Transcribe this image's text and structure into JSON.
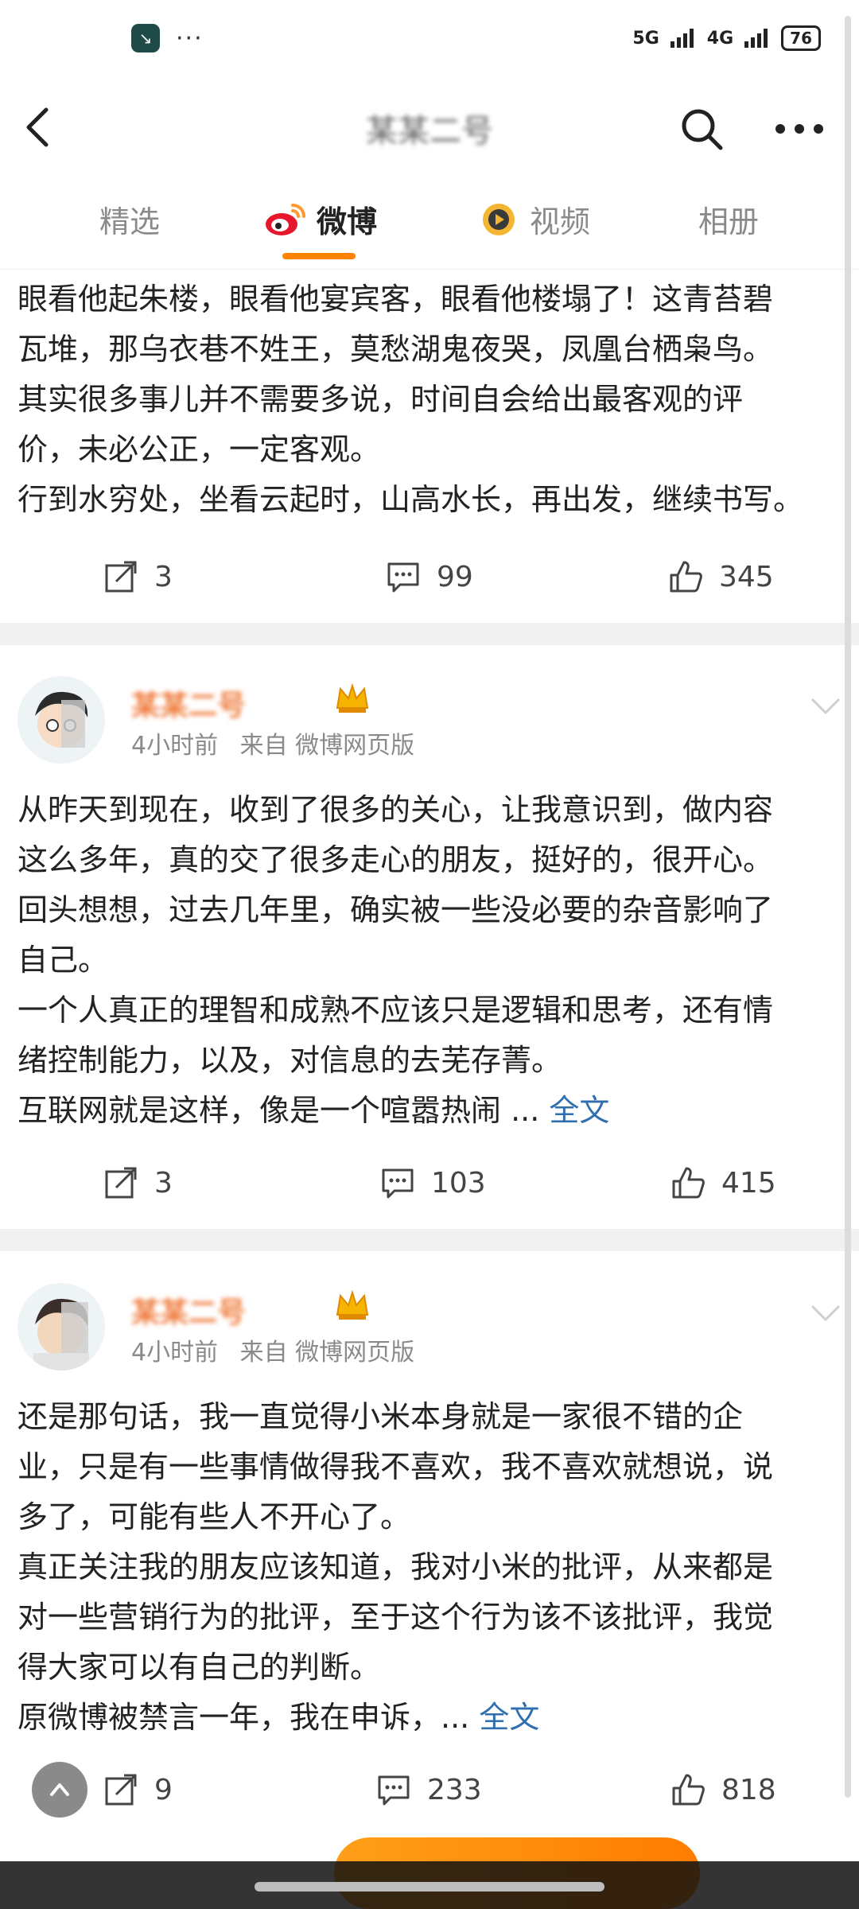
{
  "status_bar": {
    "network": "5G",
    "network2": "4G",
    "battery": "76"
  },
  "nav": {
    "title": "某某二号"
  },
  "tabs": [
    {
      "label": "精选",
      "active": false
    },
    {
      "label": "微博",
      "active": true
    },
    {
      "label": "视频",
      "active": false
    },
    {
      "label": "相册",
      "active": false
    }
  ],
  "posts": [
    {
      "lines": [
        "眼看他起朱楼，眼看他宴宾客，眼看他楼塌了！这青苔碧",
        "瓦堆，那乌衣巷不姓王，莫愁湖鬼夜哭，凤凰台栖枭鸟。",
        "其实很多事儿并不需要多说，时间自会给出最客观的评",
        "价，未必公正，一定客观。",
        "行到水穷处，坐看云起时，山高水长，再出发，继续书写。"
      ],
      "reposts": "3",
      "comments": "99",
      "likes": "345"
    },
    {
      "username": "某某二号",
      "time": "4小时前",
      "source": "来自 微博网页版",
      "lines": [
        "从昨天到现在，收到了很多的关心，让我意识到，做内容",
        "这么多年，真的交了很多走心的朋友，挺好的，很开心。",
        "回头想想，过去几年里，确实被一些没必要的杂音影响了",
        "自己。",
        "一个人真正的理智和成熟不应该只是逻辑和思考，还有情",
        "绪控制能力，以及，对信息的去芜存菁。",
        "互联网就是这样，像是一个喧嚣热闹 ..."
      ],
      "full_text": "全文",
      "reposts": "3",
      "comments": "103",
      "likes": "415"
    },
    {
      "username": "某某二号",
      "time": "4小时前",
      "source": "来自 微博网页版",
      "lines": [
        "还是那句话，我一直觉得小米本身就是一家很不错的企",
        "业，只是有一些事情做得我不喜欢，我不喜欢就想说，说",
        "多了，可能有些人不开心了。",
        "真正关注我的朋友应该知道，我对小米的批评，从来都是",
        "对一些营销行为的批评，至于这个行为该不该批评，我觉",
        "得大家可以有自己的判断。",
        "原微博被禁言一年，我在申诉，..."
      ],
      "full_text": "全文",
      "reposts": "9",
      "comments": "233",
      "likes": "818"
    }
  ],
  "colors": {
    "accent": "#ff8200",
    "link": "#2f6fb0"
  }
}
